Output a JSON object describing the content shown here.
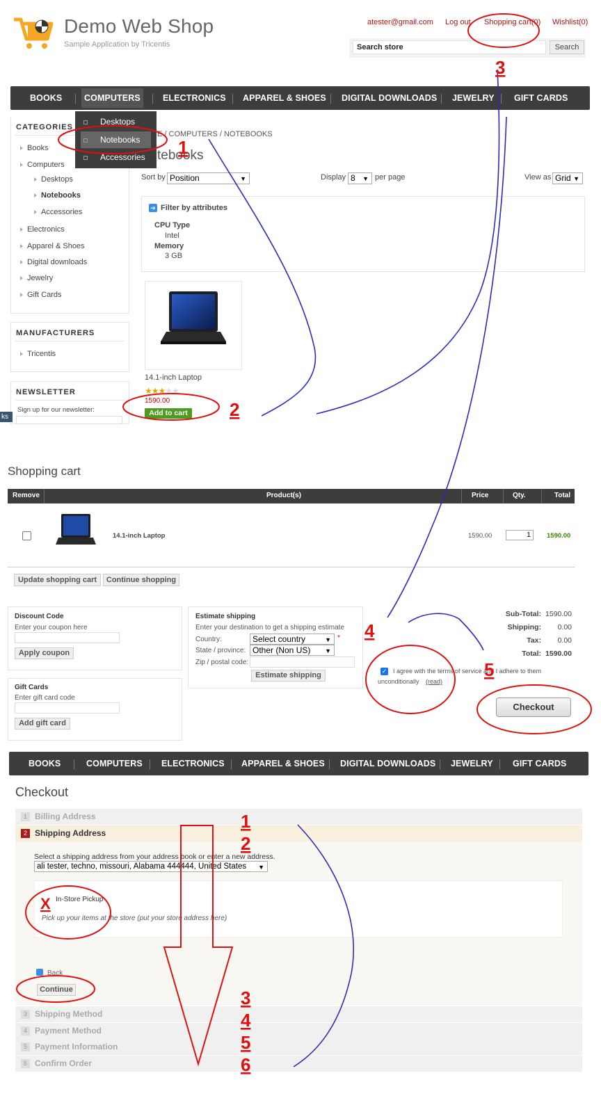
{
  "header": {
    "title": "Demo Web Shop",
    "subtitle": "Sample Application by Tricentis",
    "links": {
      "account": "atester@gmail.com",
      "logout": "Log out",
      "cart": "Shopping cart(0)",
      "wishlist": "Wishlist(0)"
    },
    "search": {
      "value": "Search store",
      "button": "Search"
    }
  },
  "menu": [
    "BOOKS",
    "COMPUTERS",
    "ELECTRONICS",
    "APPAREL & SHOES",
    "DIGITAL DOWNLOADS",
    "JEWELRY",
    "GIFT CARDS"
  ],
  "dropdown": [
    "Desktops",
    "Notebooks",
    "Accessories"
  ],
  "sidebar": {
    "categories_title": "CATEGORIES",
    "categories": [
      "Books",
      "Computers",
      "Desktops",
      "Notebooks",
      "Accessories",
      "Electronics",
      "Apparel & Shoes",
      "Digital downloads",
      "Jewelry",
      "Gift Cards"
    ],
    "manufacturers_title": "MANUFACTURERS",
    "manufacturers": [
      "Tricentis"
    ],
    "newsletter_title": "NEWSLETTER",
    "newsletter_text": "Sign up for our newsletter:",
    "edge_tab": "ks"
  },
  "catalog": {
    "breadcrumb": "E / COMPUTERS / NOTEBOOKS",
    "page_title": "tebooks",
    "sort_label": "Sort by",
    "sort_value": "Position",
    "display_label": "Display",
    "display_value": "8",
    "per_page": "per page",
    "view_label": "View as",
    "view_value": "Grid",
    "filter_title": "Filter by attributes",
    "filters": [
      {
        "name": "CPU Type",
        "value": "Intel"
      },
      {
        "name": "Memory",
        "value": "3 GB"
      }
    ],
    "product": {
      "name": "14.1-inch Laptop",
      "price": "1590.00",
      "add_button": "Add to cart",
      "rating": 0.6
    }
  },
  "cart": {
    "title": "Shopping cart",
    "columns": [
      "Remove",
      "Product(s)",
      "Price",
      "Qty.",
      "Total"
    ],
    "rows": [
      {
        "product": "14.1-inch Laptop",
        "price": "1590.00",
        "qty": "1",
        "total": "1590.00"
      }
    ],
    "update_button": "Update shopping cart",
    "continue_button": "Continue shopping",
    "discount": {
      "title": "Discount Code",
      "text": "Enter your coupon here",
      "button": "Apply coupon"
    },
    "giftcard": {
      "title": "Gift Cards",
      "text": "Enter gift card code",
      "button": "Add gift card"
    },
    "estimate": {
      "title": "Estimate shipping",
      "text": "Enter your destination to get a shipping estimate",
      "country_label": "Country:",
      "country_value": "Select country",
      "required": "*",
      "state_label": "State / province:",
      "state_value": "Other (Non US)",
      "zip_label": "Zip / postal code:",
      "button": "Estimate shipping"
    },
    "totals": [
      {
        "label": "Sub-Total:",
        "value": "1590.00"
      },
      {
        "label": "Shipping:",
        "value": "0.00"
      },
      {
        "label": "Tax:",
        "value": "0.00"
      },
      {
        "label": "Total:",
        "value": "1590.00"
      }
    ],
    "terms_line1": "I agree with the terms of service and I adhere to them",
    "terms_line2": "unconditionally",
    "terms_link": "(read)",
    "checkout_button": "Checkout"
  },
  "checkout": {
    "title": "Checkout",
    "steps": [
      {
        "num": "1",
        "label": "Billing Address"
      },
      {
        "num": "2",
        "label": "Shipping Address"
      },
      {
        "num": "3",
        "label": "Shipping Method"
      },
      {
        "num": "4",
        "label": "Payment Method"
      },
      {
        "num": "5",
        "label": "Payment Information"
      },
      {
        "num": "6",
        "label": "Confirm Order"
      }
    ],
    "address_text": "Select a shipping address from your address book or enter a new address.",
    "address_value": "ali tester, techno, missouri, Alabama 444444, United States",
    "pickup_label": "In-Store Pickup",
    "pickup_text": "Pick up your items at the store (put your store address here)",
    "back_label": "Back",
    "continue_button": "Continue"
  },
  "annotations": {
    "top": [
      "1",
      "2",
      "3"
    ],
    "cart": [
      "4",
      "5"
    ],
    "checkout": [
      "1",
      "2",
      "3",
      "4",
      "5",
      "6"
    ],
    "cross": "X"
  },
  "colors": {
    "menu_bg": "#3d3d3d",
    "link_red": "#b01010",
    "annotation_red": "#d11",
    "annotation_blue": "#2b2bb5",
    "add_green": "#4d9b20",
    "price_red": "#c00",
    "total_green": "#3a8a00"
  }
}
